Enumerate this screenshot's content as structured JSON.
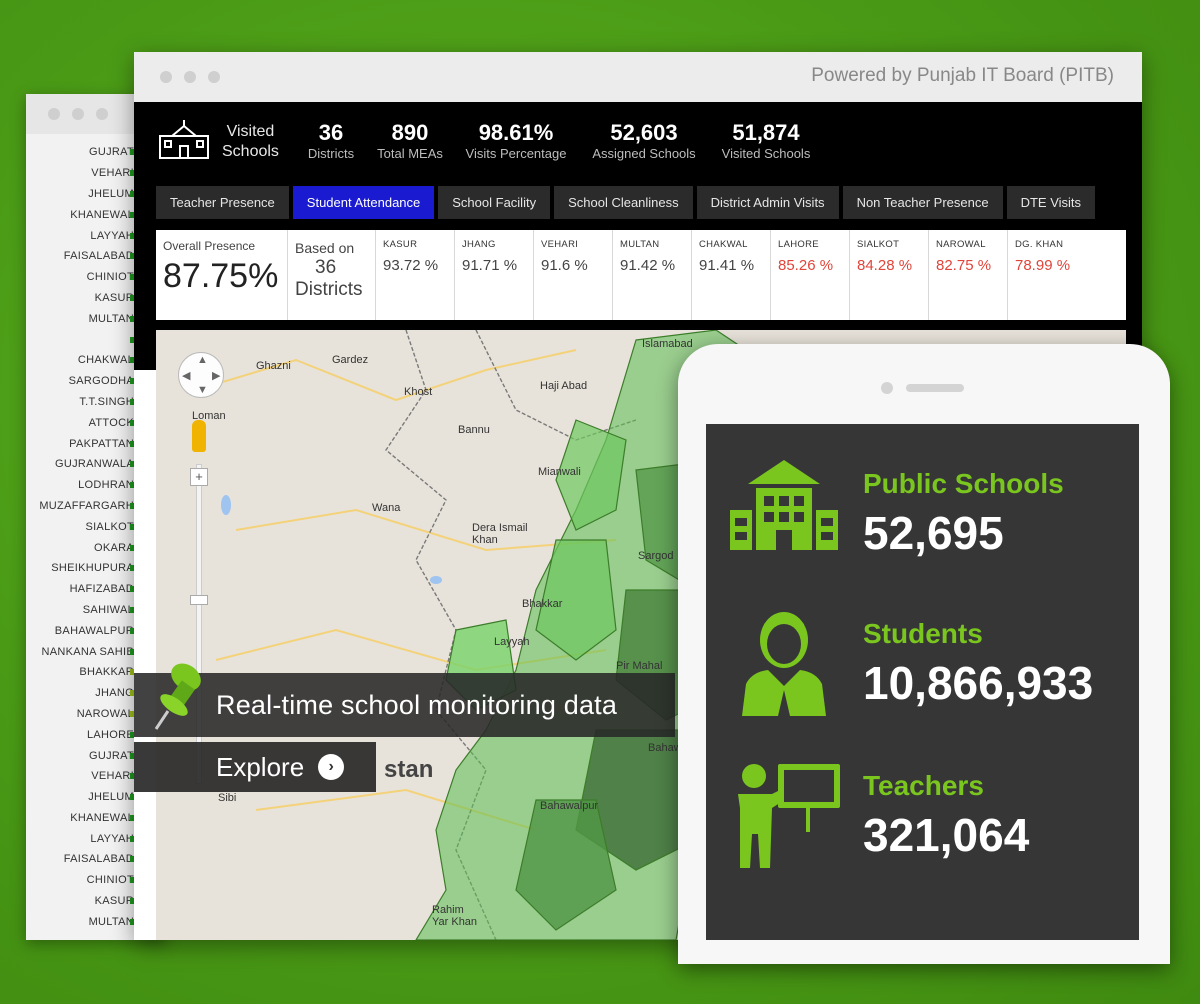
{
  "back_window": {
    "districts": [
      "GUJRAT",
      "VEHARI",
      "JHELUM",
      "KHANEWAL",
      "LAYYAH",
      "FAISALABAD",
      "CHINIOT",
      "KASUR",
      "MULTAN",
      "",
      "CHAKWAL",
      "SARGODHA",
      "T.T.SINGH",
      "ATTOCK",
      "PAKPATTAN",
      "GUJRANWALA",
      "LODHRAN",
      "MUZAFFARGARH",
      "SIALKOT",
      "OKARA",
      "SHEIKHUPURA",
      "HAFIZABAD",
      "SAHIWAL",
      "BAHAWALPUR",
      "NANKANA SAHIB",
      "BHAKKAR",
      "JHANG",
      "NAROWAL",
      "LAHORE",
      "GUJRAT",
      "VEHARI",
      "JHELUM",
      "KHANEWAL",
      "LAYYAH",
      "FAISALABAD",
      "CHINIOT",
      "KASUR",
      "MULTAN"
    ]
  },
  "main_window": {
    "powered_by": "Powered by Punjab IT Board (PITB)",
    "visited_label_1": "Visited",
    "visited_label_2": "Schools",
    "stats": [
      {
        "value": "36",
        "label": "Districts"
      },
      {
        "value": "890",
        "label": "Total MEAs"
      },
      {
        "value": "98.61%",
        "label": "Visits Percentage"
      },
      {
        "value": "52,603",
        "label": "Assigned Schools"
      },
      {
        "value": "51,874",
        "label": "Visited Schools"
      }
    ],
    "tabs": [
      "Teacher Presence",
      "Student Attendance",
      "School Facility",
      "School Cleanliness",
      "District Admin Visits",
      "Non Teacher Presence",
      "DTE Visits"
    ],
    "active_tab": "Student Attendance",
    "overall": {
      "title": "Overall Presence",
      "value": "87.75%"
    },
    "based_on": {
      "line1": "Based on",
      "line2": "36",
      "line3": "Districts"
    },
    "districts": [
      {
        "name": "KASUR",
        "value": "93.72 %",
        "low": false
      },
      {
        "name": "JHANG",
        "value": "91.71 %",
        "low": false
      },
      {
        "name": "VEHARI",
        "value": "91.6 %",
        "low": false
      },
      {
        "name": "MULTAN",
        "value": "91.42 %",
        "low": false
      },
      {
        "name": "CHAKWAL",
        "value": "91.41 %",
        "low": false
      },
      {
        "name": "LAHORE",
        "value": "85.26 %",
        "low": true
      },
      {
        "name": "SIALKOT",
        "value": "84.28 %",
        "low": true
      },
      {
        "name": "NAROWAL",
        "value": "82.75 %",
        "low": true
      },
      {
        "name": "DG. KHAN",
        "value": "78.99 %",
        "low": true
      }
    ],
    "map_labels": [
      "Ghazni",
      "Gardez",
      "Khost",
      "Haji Abad",
      "Islamabad",
      "Loman",
      "Bannu",
      "Mianwali",
      "Wana",
      "Dera Ismail Khan",
      "Sargod",
      "Bhakkar",
      "Layyah",
      "Pir Mahal",
      "Bahawa",
      "Bahawalpur",
      "Sibi",
      "Rahim Yar Khan",
      "stan"
    ]
  },
  "banner": {
    "text": "Real-time school monitoring data",
    "explore": "Explore"
  },
  "tablet": {
    "metrics": [
      {
        "label": "Public Schools",
        "value": "52,695",
        "icon": "building-icon"
      },
      {
        "label": "Students",
        "value": "10,866,933",
        "icon": "student-icon"
      },
      {
        "label": "Teachers",
        "value": "321,064",
        "icon": "teacher-icon"
      }
    ]
  },
  "colors": {
    "accent_green": "#7ac61f",
    "active_tab": "#1a1ad0",
    "low_value": "#e0443a",
    "background_green": "#4a9a16"
  }
}
